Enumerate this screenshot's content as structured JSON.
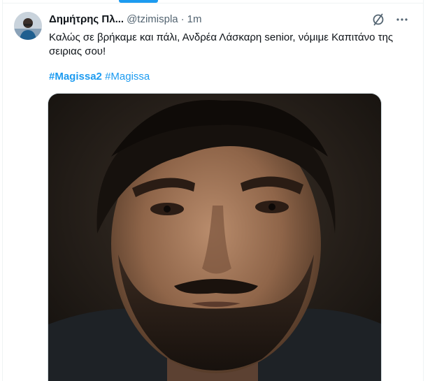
{
  "tweet": {
    "author": {
      "display_name": "Δημήτρης Πλ...",
      "handle": "@tzimispla",
      "separator": "·",
      "time": "1m"
    },
    "text": "Καλώς σε βρήκαμε και πάλι, Ανδρέα Λάσκαρη senior, νόμιμε Καπιτάνο της σειριας σου!",
    "hashtags": [
      {
        "label": "#Magissa2",
        "bold": true
      },
      {
        "label": "#Magissa",
        "bold": false
      }
    ],
    "media": {
      "kind": "photo"
    }
  },
  "icons": {
    "grok": "grok-slash-icon",
    "more": "more-dots-icon"
  },
  "colors": {
    "accent": "#1d9bf0",
    "text": "#0f1419",
    "secondary": "#536471"
  }
}
